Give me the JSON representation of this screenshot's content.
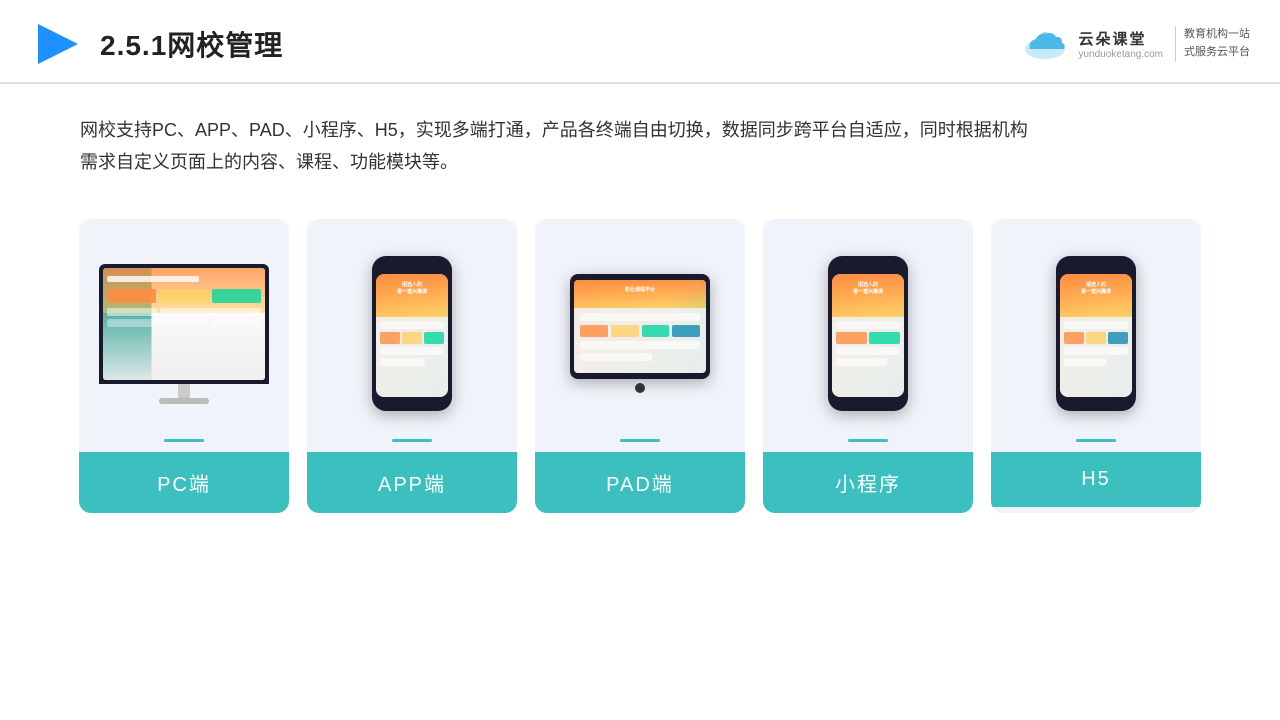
{
  "header": {
    "title": "2.5.1网校管理",
    "brand": {
      "name": "云朵课堂",
      "url": "yunduoketang.com",
      "tagline": "教育机构一站\n式服务云平台"
    }
  },
  "description": {
    "text": "网校支持PC、APP、PAD、小程序、H5，实现多端打通，产品各终端自由切换，数据同步跨平台自适应，同时根据机构需求自定义页面上的内容、课程、功能模块等。"
  },
  "cards": [
    {
      "id": "pc",
      "label": "PC端",
      "type": "monitor"
    },
    {
      "id": "app",
      "label": "APP端",
      "type": "phone"
    },
    {
      "id": "pad",
      "label": "PAD端",
      "type": "tablet"
    },
    {
      "id": "miniprogram",
      "label": "小程序",
      "type": "phone"
    },
    {
      "id": "h5",
      "label": "H5",
      "type": "phone"
    }
  ],
  "colors": {
    "teal": "#3BBFBF",
    "bg_card": "#f0f4fa",
    "text_dark": "#222222",
    "text_body": "#333333"
  }
}
